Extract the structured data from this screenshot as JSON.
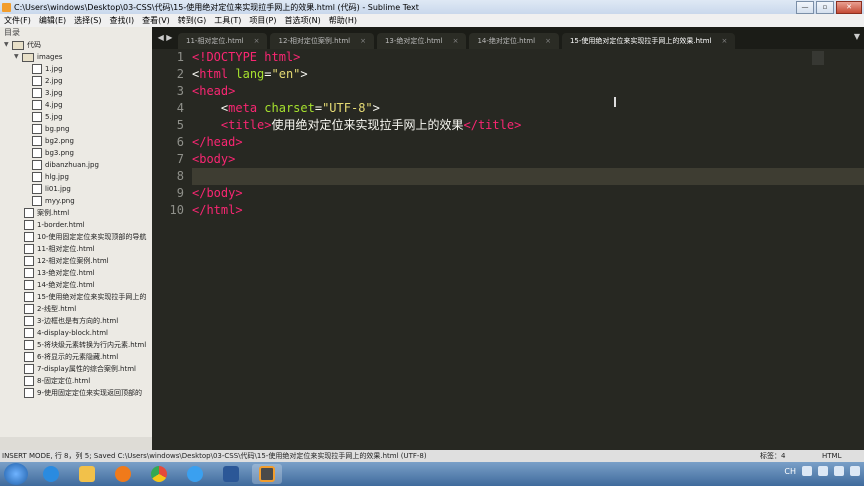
{
  "window": {
    "title": "C:\\Users\\windows\\Desktop\\03-CSS\\代码\\15-使用绝对定位来实现拉手网上的效果.html (代码) - Sublime Text",
    "minimize": "—",
    "maximize": "▫",
    "close": "✕"
  },
  "menu": [
    "文件(F)",
    "编辑(E)",
    "选择(S)",
    "查找(I)",
    "查看(V)",
    "转到(G)",
    "工具(T)",
    "项目(P)",
    "首选项(N)",
    "帮助(H)"
  ],
  "sidebar": {
    "header": "目录",
    "root_folder": "代码",
    "images_folder": "images",
    "image_files": [
      "1.jpg",
      "2.jpg",
      "3.jpg",
      "4.jpg",
      "5.jpg",
      "bg.png",
      "bg2.png",
      "bg3.png",
      "dibanzhuan.jpg",
      "hlg.jpg",
      "li01.jpg",
      "myy.png"
    ],
    "files": [
      "案例.html",
      "1-border.html",
      "10-使用固定定位来实现顶部的导航",
      "11-相对定位.html",
      "12-相对定位案例.html",
      "13-绝对定位.html",
      "14-绝对定位.html",
      "15-使用绝对定位来实现拉手网上的",
      "2-线型.html",
      "3-边框也是有方向的.html",
      "4-display-block.html",
      "5-将块级元素转换为行内元素.html",
      "6-将显示的元素隐藏.html",
      "7-display属性的综合案例.html",
      "8-固定定位.html",
      "9-使用固定定位来实现返回顶部的"
    ]
  },
  "tabs": {
    "nav_prev": "◀",
    "nav_next": "▶",
    "items": [
      "11-相对定位.html",
      "12-相对定位案例.html",
      "13-绝对定位.html",
      "14-绝对定位.html",
      "15-使用绝对定位来实现拉手网上的效果.html"
    ],
    "active_index": 4,
    "close_glyph": "×",
    "overflow": "▼"
  },
  "editor": {
    "line_numbers": [
      "1",
      "2",
      "3",
      "4",
      "5",
      "6",
      "7",
      "8",
      "9",
      "10"
    ],
    "current_line": 8,
    "code": {
      "l1": "<!DOCTYPE html>",
      "l2_open": "<",
      "l2_tag": "html",
      "l2_attr": " lang",
      "l2_eq": "=",
      "l2_val": "\"en\"",
      "l2_close": ">",
      "l3_tag": "<head>",
      "l4_indent": "    ",
      "l4_open": "<",
      "l4_tag": "meta",
      "l4_attr": " charset",
      "l4_eq": "=",
      "l4_val": "\"UTF-8\"",
      "l4_close": ">",
      "l5_indent": "    ",
      "l5_otag": "<title>",
      "l5_text": "使用绝对定位来实现拉手网上的效果",
      "l5_ctag": "</title>",
      "l6_tag": "</head>",
      "l7_tag": "<body>",
      "l8": "",
      "l9_tag": "</body>",
      "l10_tag": "</html>"
    }
  },
  "statusbar": {
    "left": "INSERT MODE, 行 8，列 5; Saved C:\\Users\\windows\\Desktop\\03-CSS\\代码\\15-使用绝对定位来实现拉手网上的效果.html (UTF-8)",
    "tab_size": "标签：4",
    "syntax": "HTML"
  },
  "taskbar": {
    "apps": [
      "windows-start",
      "ie-browser",
      "file-explorer",
      "media-player",
      "chrome-browser",
      "baidu-netdisk",
      "word",
      "sublime-text"
    ],
    "colors": {
      "ie": "#2a8be0",
      "explorer": "#f2c14a",
      "media": "#f07a1a",
      "chrome": "#e54a3a",
      "baidu": "#3aa0f0",
      "word": "#2b5797",
      "sublime": "#4a4a4a"
    },
    "tray_lang": "CH"
  }
}
